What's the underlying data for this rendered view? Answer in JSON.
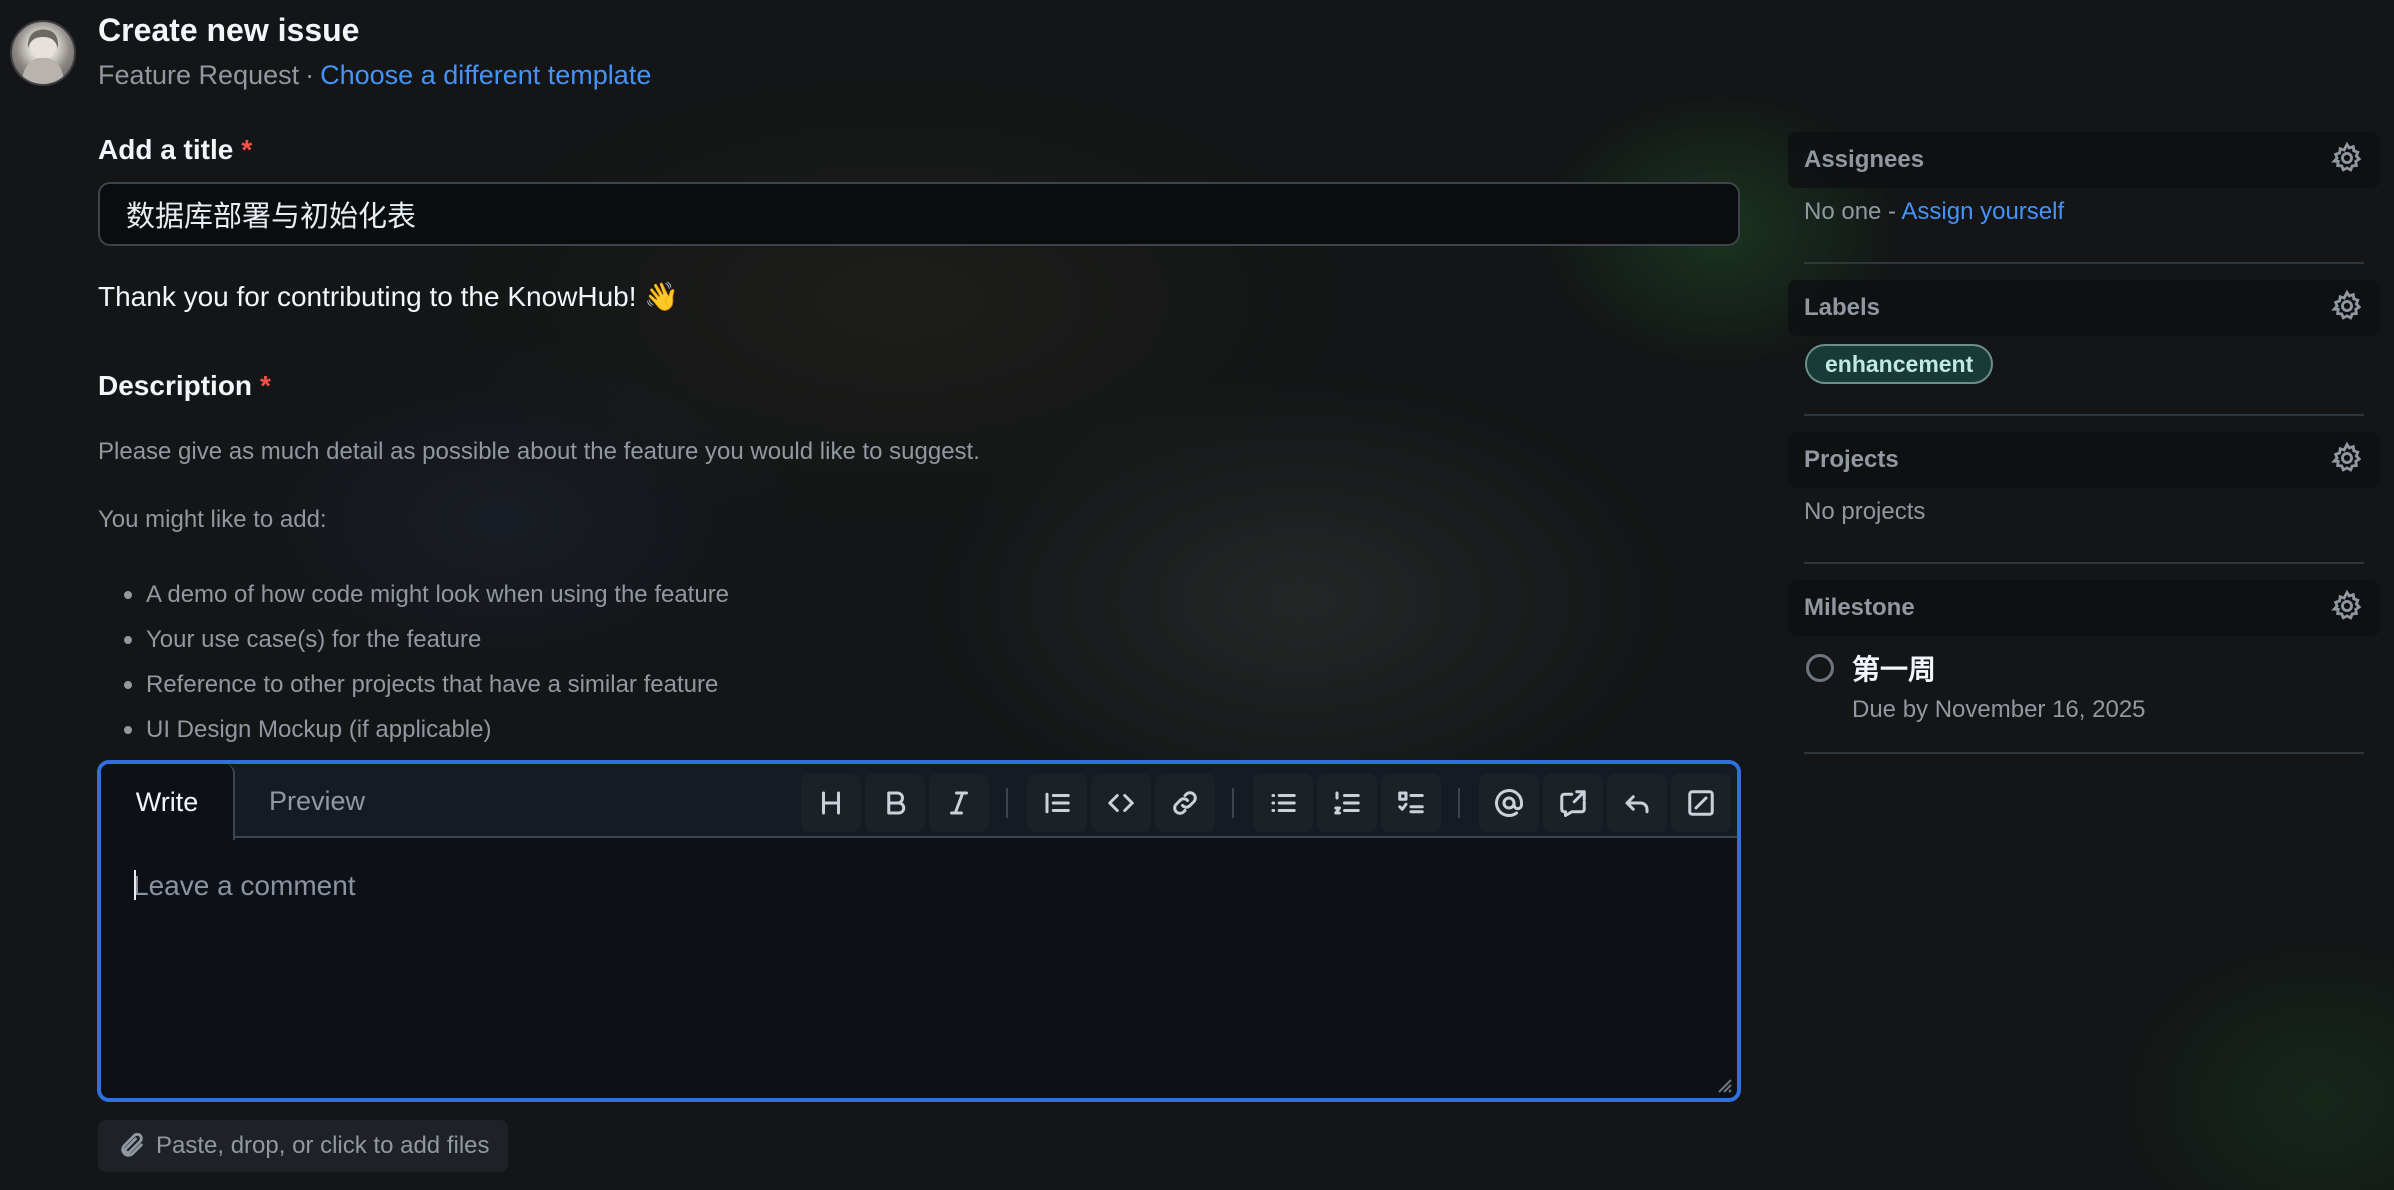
{
  "header": {
    "title": "Create new issue",
    "template_name": "Feature Request",
    "separator": "·",
    "change_template_link": "Choose a different template"
  },
  "form": {
    "title_label": "Add a title",
    "required_mark": "*",
    "title_value": "数据库部署与初始化表",
    "thanks_text": "Thank you for contributing to the KnowHub! 👋",
    "description_label": "Description",
    "help_intro": "Please give as much detail as possible about the feature you would like to suggest.",
    "help_suggest": "You might like to add:",
    "suggestions": [
      "A demo of how code might look when using the feature",
      "Your use case(s) for the feature",
      "Reference to other projects that have a similar feature",
      "UI Design Mockup (if applicable)"
    ]
  },
  "editor": {
    "tabs": [
      "Write",
      "Preview"
    ],
    "active_tab": "Write",
    "placeholder": "Leave a comment",
    "toolbar": [
      "heading-icon",
      "bold-icon",
      "italic-icon",
      "quote-icon",
      "code-icon",
      "link-icon",
      "unordered-list-icon",
      "ordered-list-icon",
      "task-list-icon",
      "mention-icon",
      "reference-icon",
      "reply-icon",
      "fullscreen-icon"
    ],
    "attach_label": "Paste, drop, or click to add files"
  },
  "sidebar": {
    "assignees": {
      "title": "Assignees",
      "value": "No one - ",
      "action": "Assign yourself"
    },
    "labels": {
      "title": "Labels",
      "items": [
        "enhancement"
      ],
      "label_color": "#1a3a37"
    },
    "projects": {
      "title": "Projects",
      "value": "No projects"
    },
    "milestone": {
      "title": "Milestone",
      "name": "第一周",
      "due": "Due by November 16, 2025"
    }
  },
  "colors": {
    "accent": "#4493f8",
    "focus_border": "#2f6fde",
    "required": "#f85149",
    "background": "#131516"
  }
}
